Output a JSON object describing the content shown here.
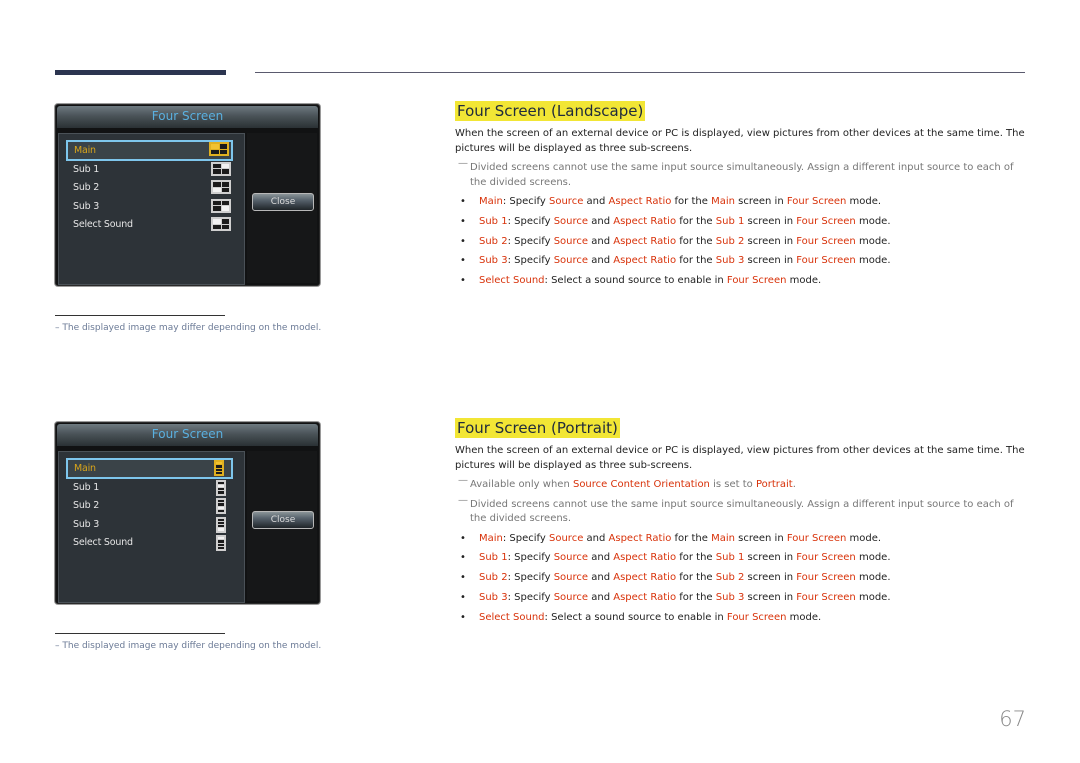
{
  "page": {
    "number": "67"
  },
  "panels": [
    {
      "title": "Four Screen",
      "icon_type": "grid",
      "close_label": "Close",
      "items": [
        {
          "label": "Main",
          "selected": true,
          "icon": "grid-main-icon",
          "highlight": [
            0
          ]
        },
        {
          "label": "Sub 1",
          "selected": false,
          "icon": "grid-sub1-icon",
          "highlight": [
            1
          ]
        },
        {
          "label": "Sub 2",
          "selected": false,
          "icon": "grid-sub2-icon",
          "highlight": [
            2
          ]
        },
        {
          "label": "Sub 3",
          "selected": false,
          "icon": "grid-sub3-icon",
          "highlight": [
            3
          ]
        },
        {
          "label": "Select Sound",
          "selected": false,
          "icon": "grid-sound-icon",
          "highlight": [
            0
          ]
        }
      ],
      "note": "– The displayed image may differ depending on the model."
    },
    {
      "title": "Four Screen",
      "icon_type": "column",
      "close_label": "Close",
      "items": [
        {
          "label": "Main",
          "selected": true,
          "icon": "column-main-icon",
          "highlight": [
            0
          ]
        },
        {
          "label": "Sub 1",
          "selected": false,
          "icon": "column-sub1-icon",
          "highlight": [
            1
          ]
        },
        {
          "label": "Sub 2",
          "selected": false,
          "icon": "column-sub2-icon",
          "highlight": [
            2
          ]
        },
        {
          "label": "Sub 3",
          "selected": false,
          "icon": "column-sub3-icon",
          "highlight": [
            3
          ]
        },
        {
          "label": "Select Sound",
          "selected": false,
          "icon": "column-sound-icon",
          "highlight": [
            0
          ]
        }
      ],
      "note": "– The displayed image may differ depending on the model."
    }
  ],
  "sections": [
    {
      "title": "Four Screen (Landscape)",
      "paragraph": "When the screen of an external device or PC is displayed, view pictures from other devices at the same time. The pictures will be displayed as three sub-screens.",
      "notes": [
        [
          {
            "t": "Divided screens cannot use the same input source simultaneously. Assign a different input source to each of the divided screens.",
            "hl": false
          }
        ]
      ],
      "bullets": [
        [
          {
            "t": "Main",
            "hl": true
          },
          {
            "t": ": Specify ",
            "hl": false
          },
          {
            "t": "Source",
            "hl": true
          },
          {
            "t": " and ",
            "hl": false
          },
          {
            "t": "Aspect Ratio",
            "hl": true
          },
          {
            "t": " for the ",
            "hl": false
          },
          {
            "t": "Main",
            "hl": true
          },
          {
            "t": " screen in ",
            "hl": false
          },
          {
            "t": "Four Screen",
            "hl": true
          },
          {
            "t": " mode.",
            "hl": false
          }
        ],
        [
          {
            "t": "Sub 1",
            "hl": true
          },
          {
            "t": ": Specify ",
            "hl": false
          },
          {
            "t": "Source",
            "hl": true
          },
          {
            "t": " and ",
            "hl": false
          },
          {
            "t": "Aspect Ratio",
            "hl": true
          },
          {
            "t": " for the ",
            "hl": false
          },
          {
            "t": "Sub 1",
            "hl": true
          },
          {
            "t": " screen in ",
            "hl": false
          },
          {
            "t": "Four Screen",
            "hl": true
          },
          {
            "t": " mode.",
            "hl": false
          }
        ],
        [
          {
            "t": "Sub 2",
            "hl": true
          },
          {
            "t": ": Specify ",
            "hl": false
          },
          {
            "t": "Source",
            "hl": true
          },
          {
            "t": " and ",
            "hl": false
          },
          {
            "t": "Aspect Ratio",
            "hl": true
          },
          {
            "t": " for the ",
            "hl": false
          },
          {
            "t": "Sub 2",
            "hl": true
          },
          {
            "t": " screen in ",
            "hl": false
          },
          {
            "t": "Four Screen",
            "hl": true
          },
          {
            "t": " mode.",
            "hl": false
          }
        ],
        [
          {
            "t": "Sub 3",
            "hl": true
          },
          {
            "t": ": Specify ",
            "hl": false
          },
          {
            "t": "Source",
            "hl": true
          },
          {
            "t": " and ",
            "hl": false
          },
          {
            "t": "Aspect Ratio",
            "hl": true
          },
          {
            "t": " for the ",
            "hl": false
          },
          {
            "t": "Sub 3",
            "hl": true
          },
          {
            "t": " screen in ",
            "hl": false
          },
          {
            "t": "Four Screen",
            "hl": true
          },
          {
            "t": " mode.",
            "hl": false
          }
        ],
        [
          {
            "t": "Select Sound",
            "hl": true
          },
          {
            "t": ": Select a sound source to enable in ",
            "hl": false
          },
          {
            "t": "Four Screen",
            "hl": true
          },
          {
            "t": " mode.",
            "hl": false
          }
        ]
      ]
    },
    {
      "title": "Four Screen (Portrait)",
      "paragraph": "When the screen of an external device or PC is displayed, view pictures from other devices at the same time. The pictures will be displayed as three sub-screens.",
      "notes": [
        [
          {
            "t": "Available only when ",
            "hl": false
          },
          {
            "t": "Source Content Orientation",
            "hl": true
          },
          {
            "t": " is set to ",
            "hl": false
          },
          {
            "t": "Portrait",
            "hl": true
          },
          {
            "t": ".",
            "hl": false
          }
        ],
        [
          {
            "t": "Divided screens cannot use the same input source simultaneously. Assign a different input source to each of the divided screens.",
            "hl": false
          }
        ]
      ],
      "bullets": [
        [
          {
            "t": "Main",
            "hl": true
          },
          {
            "t": ": Specify ",
            "hl": false
          },
          {
            "t": "Source",
            "hl": true
          },
          {
            "t": " and ",
            "hl": false
          },
          {
            "t": "Aspect Ratio",
            "hl": true
          },
          {
            "t": " for the ",
            "hl": false
          },
          {
            "t": "Main",
            "hl": true
          },
          {
            "t": " screen in ",
            "hl": false
          },
          {
            "t": "Four Screen",
            "hl": true
          },
          {
            "t": " mode.",
            "hl": false
          }
        ],
        [
          {
            "t": "Sub 1",
            "hl": true
          },
          {
            "t": ": Specify ",
            "hl": false
          },
          {
            "t": "Source",
            "hl": true
          },
          {
            "t": " and ",
            "hl": false
          },
          {
            "t": "Aspect Ratio",
            "hl": true
          },
          {
            "t": " for the ",
            "hl": false
          },
          {
            "t": "Sub 1",
            "hl": true
          },
          {
            "t": " screen in ",
            "hl": false
          },
          {
            "t": "Four Screen",
            "hl": true
          },
          {
            "t": " mode.",
            "hl": false
          }
        ],
        [
          {
            "t": "Sub 2",
            "hl": true
          },
          {
            "t": ": Specify ",
            "hl": false
          },
          {
            "t": "Source",
            "hl": true
          },
          {
            "t": " and ",
            "hl": false
          },
          {
            "t": "Aspect Ratio",
            "hl": true
          },
          {
            "t": " for the ",
            "hl": false
          },
          {
            "t": "Sub 2",
            "hl": true
          },
          {
            "t": " screen in ",
            "hl": false
          },
          {
            "t": "Four Screen",
            "hl": true
          },
          {
            "t": " mode.",
            "hl": false
          }
        ],
        [
          {
            "t": "Sub 3",
            "hl": true
          },
          {
            "t": ": Specify ",
            "hl": false
          },
          {
            "t": "Source",
            "hl": true
          },
          {
            "t": " and ",
            "hl": false
          },
          {
            "t": "Aspect Ratio",
            "hl": true
          },
          {
            "t": " for the ",
            "hl": false
          },
          {
            "t": "Sub 3",
            "hl": true
          },
          {
            "t": " screen in ",
            "hl": false
          },
          {
            "t": "Four Screen",
            "hl": true
          },
          {
            "t": " mode.",
            "hl": false
          }
        ],
        [
          {
            "t": "Select Sound",
            "hl": true
          },
          {
            "t": ": Select a sound source to enable in ",
            "hl": false
          },
          {
            "t": "Four Screen",
            "hl": true
          },
          {
            "t": " mode.",
            "hl": false
          }
        ]
      ]
    }
  ],
  "colors": {
    "highlight_text": "#d8320a",
    "title_background": "#f2e635",
    "osd_title": "#5ab0e0",
    "osd_selected": "#d9a51a"
  }
}
